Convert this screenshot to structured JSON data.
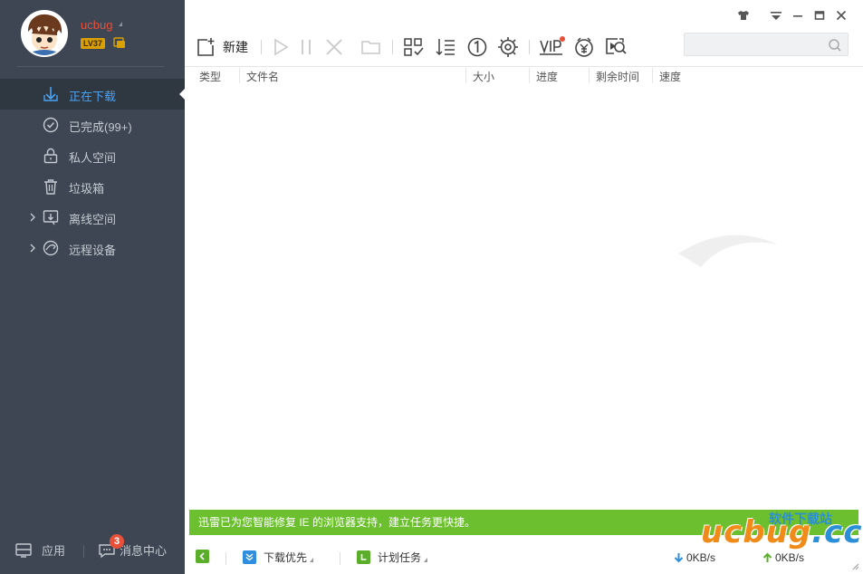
{
  "user": {
    "name": "ucbug",
    "level": "LV37"
  },
  "nav": {
    "items": [
      {
        "label": "正在下载",
        "icon": "download-arrow-icon"
      },
      {
        "label": "已完成(99+)",
        "icon": "check-circle-icon"
      },
      {
        "label": "私人空间",
        "icon": "lock-icon"
      },
      {
        "label": "垃圾箱",
        "icon": "trash-icon"
      },
      {
        "label": "离线空间",
        "icon": "cloud-download-icon"
      },
      {
        "label": "远程设备",
        "icon": "remote-device-icon"
      }
    ]
  },
  "sidebar_bottom": {
    "apps_label": "应用",
    "messages_label": "消息中心",
    "messages_count": "3"
  },
  "toolbar": {
    "new_label": "新建",
    "search_placeholder": ""
  },
  "columns": [
    "类型",
    "文件名",
    "大小",
    "进度",
    "剩余时间",
    "速度"
  ],
  "notice": "迅雷已为您智能修复 IE 的浏览器支持，建立任务更快捷。",
  "status": {
    "priority_label": "下载优先",
    "schedule_label": "计划任务",
    "download_speed": "0KB/s",
    "upload_speed": "0KB/s"
  },
  "watermark": {
    "logo": "ucbug",
    "logo_suffix": ".cc",
    "site_name": "软件下载站"
  },
  "colors": {
    "sidebar_bg": "#3d4652",
    "active_blue": "#4aa3f5",
    "notice_green": "#6cbf2e",
    "accent_red": "#e8503a"
  }
}
